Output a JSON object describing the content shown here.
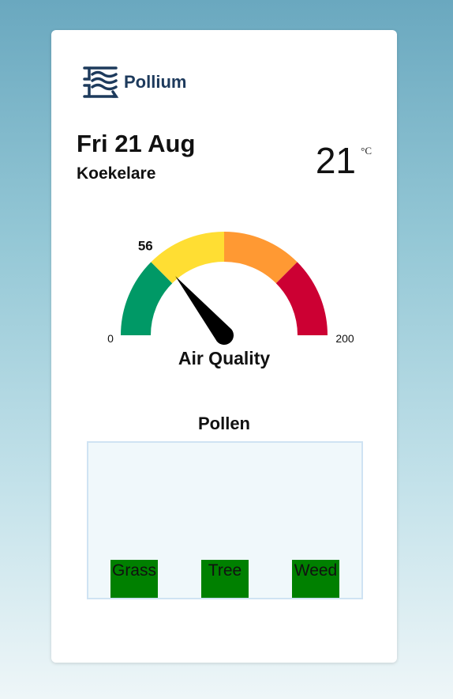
{
  "brand": {
    "name": "Pollium",
    "icon": "wind-waves-icon"
  },
  "weather": {
    "date": "Fri 21 Aug",
    "location": "Koekelare",
    "temperature": "21",
    "unit": "°C"
  },
  "air_quality": {
    "label": "Air Quality",
    "value": 56,
    "value_label": "56",
    "min": 0,
    "max": 200,
    "min_label": "0",
    "max_label": "200",
    "bands": [
      {
        "from": 0,
        "to": 50,
        "color": "#009966"
      },
      {
        "from": 50,
        "to": 100,
        "color": "#ffde33"
      },
      {
        "from": 100,
        "to": 150,
        "color": "#ff9933"
      },
      {
        "from": 150,
        "to": 200,
        "color": "#cc0033"
      }
    ],
    "needle_color": "#000000"
  },
  "pollen": {
    "title": "Pollen",
    "items": [
      {
        "name": "Grass",
        "color": "#008000"
      },
      {
        "name": "Tree",
        "color": "#008000"
      },
      {
        "name": "Weed",
        "color": "#008000"
      }
    ]
  }
}
